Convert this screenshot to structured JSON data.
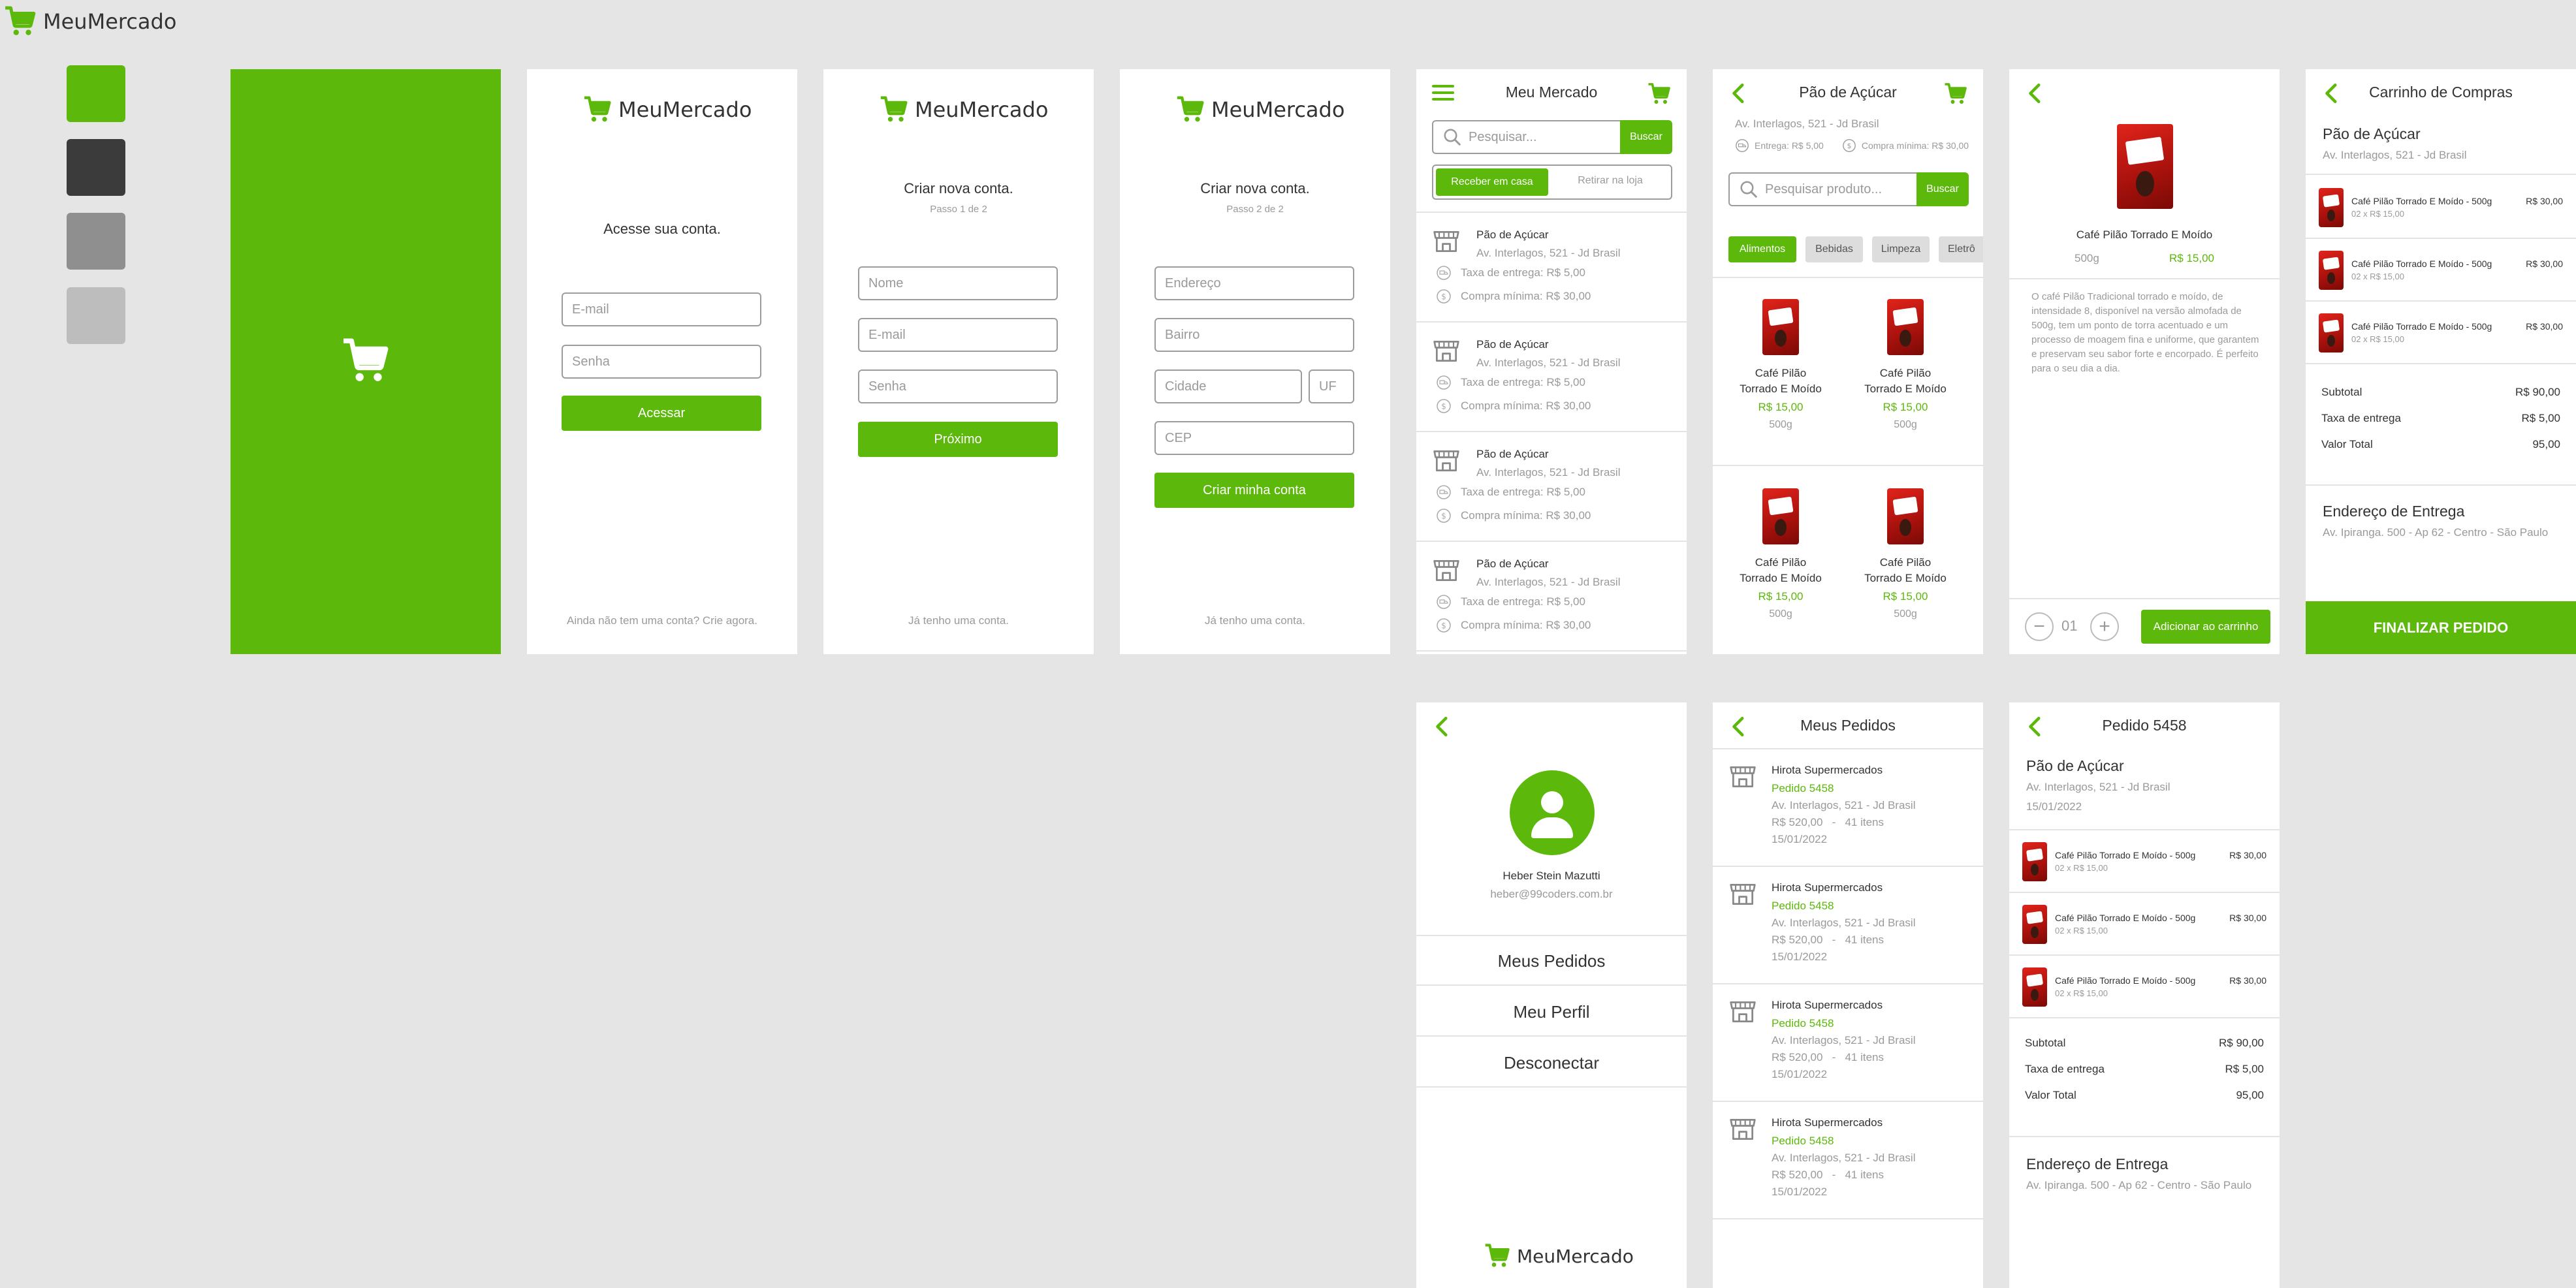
{
  "brand": {
    "name": "MeuMercado",
    "primary": "#5cb80a",
    "dark": "#3b3b3b",
    "gray": "#8f8f8f",
    "light": "#bdbdbd"
  },
  "login": {
    "heading": "Acesse sua conta.",
    "email_ph": "E-mail",
    "password_ph": "Senha",
    "submit": "Acessar",
    "footer": "Ainda não tem uma conta? Crie agora."
  },
  "signup1": {
    "heading": "Criar nova conta.",
    "step": "Passo 1 de 2",
    "name_ph": "Nome",
    "email_ph": "E-mail",
    "password_ph": "Senha",
    "next": "Próximo",
    "footer": "Já tenho uma conta."
  },
  "signup2": {
    "heading": "Criar nova conta.",
    "step": "Passo 2 de 2",
    "address_ph": "Endereço",
    "district_ph": "Bairro",
    "city_ph": "Cidade",
    "state_ph": "UF",
    "zip_ph": "CEP",
    "submit": "Criar minha conta",
    "footer": "Já tenho uma conta."
  },
  "home": {
    "title": "Meu Mercado",
    "search_ph": "Pesquisar...",
    "search_btn": "Buscar",
    "tab_delivery": "Receber em casa",
    "tab_pickup": "Retirar na loja",
    "stores": [
      {
        "name": "Pão de Açúcar",
        "address": "Av. Interlagos, 521 - Jd Brasil",
        "fee": "Taxa de entrega: R$ 5,00",
        "min": "Compra mínima: R$ 30,00"
      },
      {
        "name": "Pão de Açúcar",
        "address": "Av. Interlagos, 521 - Jd Brasil",
        "fee": "Taxa de entrega: R$ 5,00",
        "min": "Compra mínima: R$ 30,00"
      },
      {
        "name": "Pão de Açúcar",
        "address": "Av. Interlagos, 521 - Jd Brasil",
        "fee": "Taxa de entrega: R$ 5,00",
        "min": "Compra mínima: R$ 30,00"
      },
      {
        "name": "Pão de Açúcar",
        "address": "Av. Interlagos, 521 - Jd Brasil",
        "fee": "Taxa de entrega: R$ 5,00",
        "min": "Compra mínima: R$ 30,00"
      }
    ]
  },
  "store": {
    "title": "Pão de Açúcar",
    "address": "Av. Interlagos, 521 - Jd Brasil",
    "fee": "Entrega: R$ 5,00",
    "min": "Compra mínima: R$ 30,00",
    "search_ph": "Pesquisar produto...",
    "search_btn": "Buscar",
    "categories": [
      "Alimentos",
      "Bebidas",
      "Limpeza",
      "Eletrô"
    ],
    "products": [
      {
        "name1": "Café Pilão",
        "name2": "Torrado E Moído",
        "price": "R$ 15,00",
        "weight": "500g"
      },
      {
        "name1": "Café Pilão",
        "name2": "Torrado E Moído",
        "price": "R$ 15,00",
        "weight": "500g"
      },
      {
        "name1": "Café Pilão",
        "name2": "Torrado E Moído",
        "price": "R$ 15,00",
        "weight": "500g"
      },
      {
        "name1": "Café Pilão",
        "name2": "Torrado E Moído",
        "price": "R$ 15,00",
        "weight": "500g"
      }
    ]
  },
  "product": {
    "name": "Café Pilão Torrado E Moído",
    "weight": "500g",
    "price": "R$ 15,00",
    "description": "O café Pilão Tradicional torrado e moído, de intensidade 8, disponível na versão almofada de 500g, tem um ponto de torra acentuado e um processo de moagem fina e uniforme, que garantem e preservam seu sabor forte e encorpado. É perfeito para o seu dia a dia.",
    "qty": "01",
    "add_btn": "Adicionar ao carrinho"
  },
  "cart": {
    "title": "Carrinho de Compras",
    "store": "Pão de Açúcar",
    "address": "Av. Interlagos, 521 - Jd Brasil",
    "items": [
      {
        "name": "Café Pilão Torrado E Moído - 500g",
        "qty": "02 x R$ 15,00",
        "total": "R$ 30,00"
      },
      {
        "name": "Café Pilão Torrado E Moído - 500g",
        "qty": "02 x R$ 15,00",
        "total": "R$ 30,00"
      },
      {
        "name": "Café Pilão Torrado E Moído - 500g",
        "qty": "02 x R$ 15,00",
        "total": "R$ 30,00"
      }
    ],
    "subtotal_label": "Subtotal",
    "subtotal": "R$ 90,00",
    "fee_label": "Taxa de entrega",
    "fee": "R$ 5,00",
    "total_label": "Valor Total",
    "total": "95,00",
    "addr_title": "Endereço de Entrega",
    "addr": "Av. Ipiranga. 500 - Ap 62 - Centro - São Paulo",
    "finish": "FINALIZAR PEDIDO"
  },
  "profile": {
    "name": "Heber Stein Mazutti",
    "email": "heber@99coders.com.br",
    "menu": [
      "Meus Pedidos",
      "Meu Perfil",
      "Desconectar"
    ]
  },
  "orders": {
    "title": "Meus Pedidos",
    "items": [
      {
        "store": "Hirota Supermercados",
        "order": "Pedido 5458",
        "address": "Av. Interlagos, 521 - Jd Brasil",
        "value": "R$ 520,00   -   41 itens",
        "date": "15/01/2022"
      },
      {
        "store": "Hirota Supermercados",
        "order": "Pedido 5458",
        "address": "Av. Interlagos, 521 - Jd Brasil",
        "value": "R$ 520,00   -   41 itens",
        "date": "15/01/2022"
      },
      {
        "store": "Hirota Supermercados",
        "order": "Pedido 5458",
        "address": "Av. Interlagos, 521 - Jd Brasil",
        "value": "R$ 520,00   -   41 itens",
        "date": "15/01/2022"
      },
      {
        "store": "Hirota Supermercados",
        "order": "Pedido 5458",
        "address": "Av. Interlagos, 521 - Jd Brasil",
        "value": "R$ 520,00   -   41 itens",
        "date": "15/01/2022"
      }
    ]
  },
  "order_detail": {
    "title": "Pedido 5458",
    "store": "Pão de Açúcar",
    "address": "Av. Interlagos, 521 - Jd Brasil",
    "date": "15/01/2022",
    "items": [
      {
        "name": "Café Pilão Torrado E Moído - 500g",
        "qty": "02 x R$ 15,00",
        "total": "R$ 30,00"
      },
      {
        "name": "Café Pilão Torrado E Moído - 500g",
        "qty": "02 x R$ 15,00",
        "total": "R$ 30,00"
      },
      {
        "name": "Café Pilão Torrado E Moído - 500g",
        "qty": "02 x R$ 15,00",
        "total": "R$ 30,00"
      }
    ],
    "subtotal_label": "Subtotal",
    "subtotal": "R$ 90,00",
    "fee_label": "Taxa de entrega",
    "fee": "R$ 5,00",
    "total_label": "Valor Total",
    "total": "95,00",
    "addr_title": "Endereço de Entrega",
    "addr": "Av. Ipiranga. 500 - Ap 62 - Centro - São Paulo"
  }
}
